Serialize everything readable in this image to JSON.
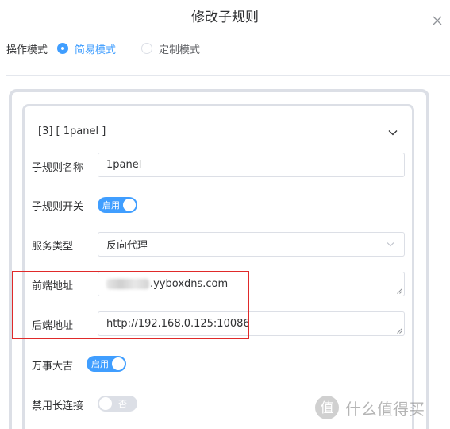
{
  "dialog": {
    "title": "修改子规则"
  },
  "mode": {
    "label": "操作模式",
    "options": [
      {
        "label": "简易模式",
        "checked": true
      },
      {
        "label": "定制模式",
        "checked": false
      }
    ]
  },
  "rule": {
    "header": "[3] [ 1panel ]",
    "fields": {
      "name": {
        "label": "子规则名称",
        "value": "1panel"
      },
      "enabled": {
        "label": "子规则开关",
        "switch_text": "启用",
        "on": true
      },
      "service_type": {
        "label": "服务类型",
        "value": "反向代理"
      },
      "frontend": {
        "label": "前端地址",
        "value": ".yyboxdns.com"
      },
      "backend": {
        "label": "后端地址",
        "value": "http://192.168.0.125:10086"
      },
      "lucky": {
        "label": "万事大吉",
        "switch_text": "启用",
        "on": true
      },
      "disable_keepalive": {
        "label": "禁用长连接",
        "switch_text": "否",
        "on": false
      }
    }
  },
  "watermark": {
    "text": "什么值得买"
  },
  "colors": {
    "accent": "#409eff",
    "highlight": "#e02a2a",
    "border": "#dcdfe6"
  }
}
